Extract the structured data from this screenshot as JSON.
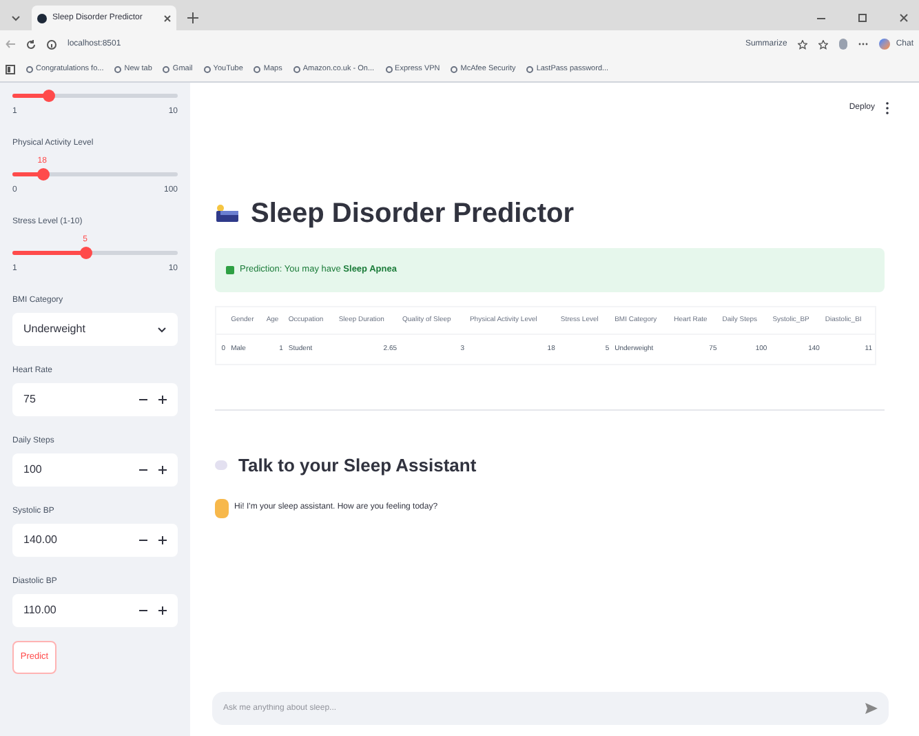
{
  "browser": {
    "tab_title": "Sleep Disorder Predictor",
    "url": "localhost:8501",
    "summarize": "Summarize",
    "copilot": "Chat",
    "bookmarks": [
      "Congratulations fo...",
      "New tab",
      "Gmail",
      "YouTube",
      "Maps",
      "Amazon.co.uk - On...",
      "Express VPN",
      "McAfee Security",
      "LastPass password..."
    ]
  },
  "sidebar": {
    "controls": [
      {
        "kind": "slider",
        "level": 0.22,
        "min": "1",
        "max": "10"
      },
      {
        "kind": "slider",
        "label": "Physical Activity Level",
        "value": "18",
        "level": 0.18,
        "min": "0",
        "max": "100"
      },
      {
        "kind": "slider",
        "label": "Stress Level (1-10)",
        "value": "5",
        "level": 0.44,
        "min": "1",
        "max": "10"
      },
      {
        "kind": "select",
        "label": "BMI Category",
        "value": "Underweight"
      },
      {
        "kind": "number",
        "label": "Heart Rate",
        "value": "75"
      },
      {
        "kind": "number",
        "label": "Daily Steps",
        "value": "100"
      },
      {
        "kind": "number",
        "label": "Systolic BP",
        "value": "140.00"
      },
      {
        "kind": "number",
        "label": "Diastolic BP",
        "value": "110.00"
      }
    ],
    "button": "Predict"
  },
  "deploy": "Deploy",
  "title": "Sleep Disorder Predictor",
  "alert": "Prediction: You may have **Sleep Apnea**",
  "table": {
    "columns": [
      "",
      "Gender",
      "Age",
      "Occupation",
      "Sleep Duration",
      "Quality of Sleep",
      "Physical Activity Level",
      "Stress Level",
      "BMI Category",
      "Heart Rate",
      "Daily Steps",
      "Systolic_BP",
      "Diastolic_BI"
    ],
    "rows": [
      [
        "0",
        "Male",
        "1",
        "Student",
        "2.65",
        "3",
        "18",
        "5",
        "Underweight",
        "75",
        "100",
        "140",
        "11"
      ]
    ]
  },
  "chat": {
    "heading": "Talk to your Sleep Assistant",
    "messages": [
      "Hi! I'm your sleep assistant. How are you feeling today?"
    ],
    "placeholder": "Ask me anything about sleep..."
  }
}
